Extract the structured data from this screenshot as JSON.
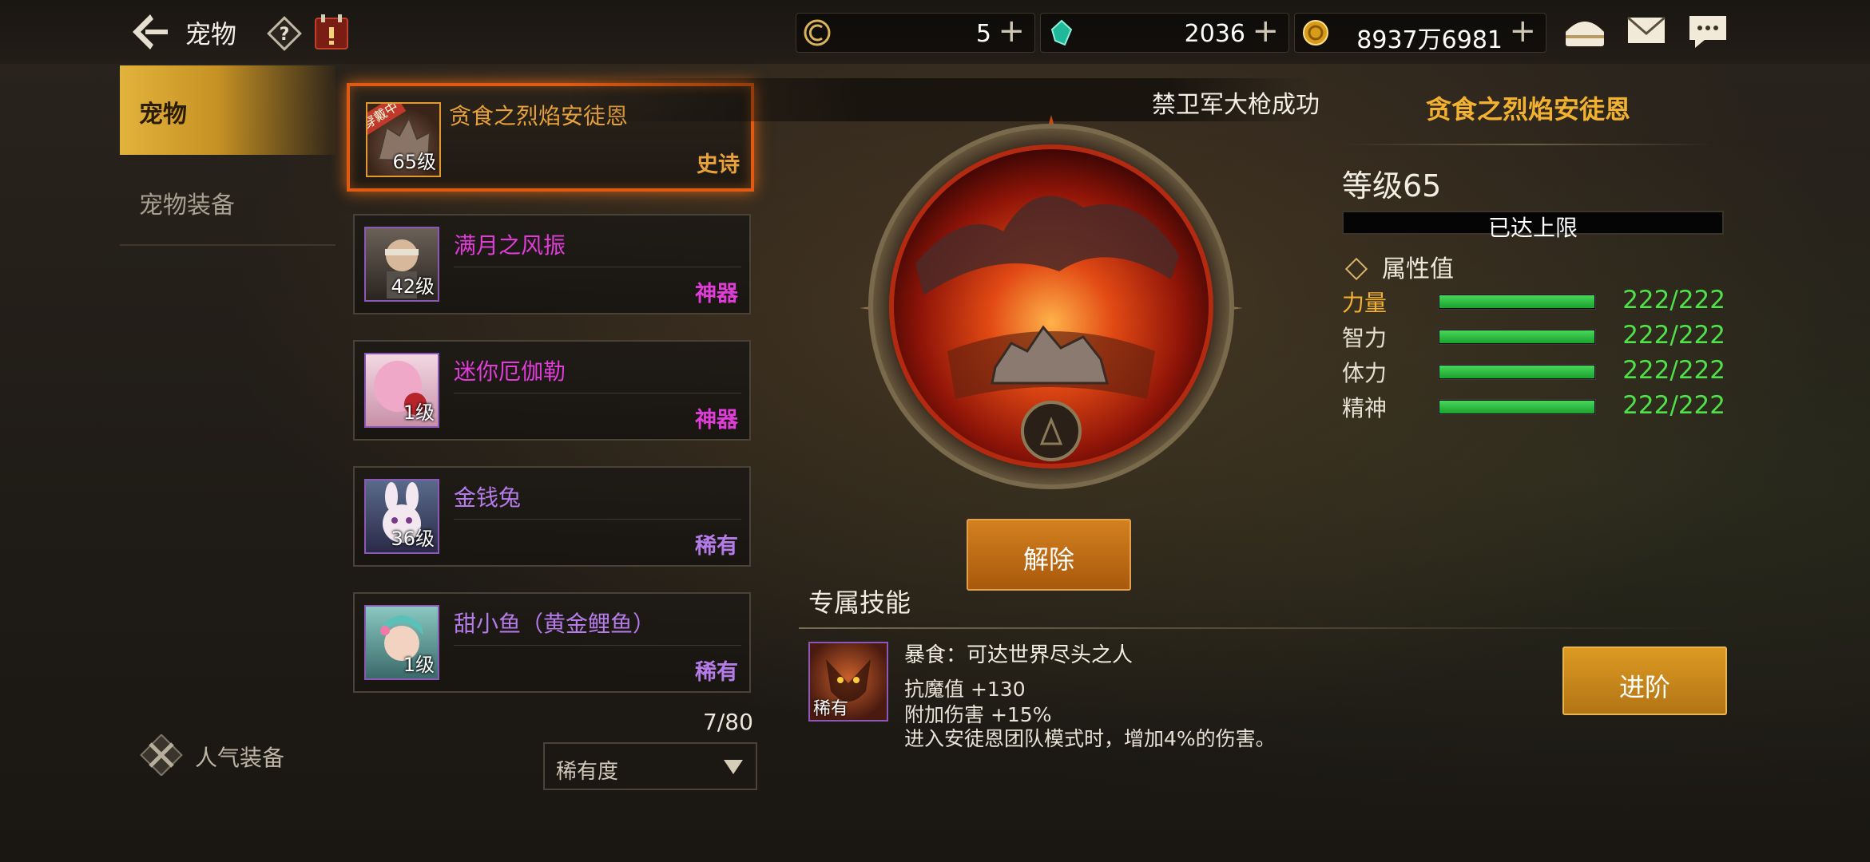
{
  "header": {
    "title": "宠物",
    "resources": [
      {
        "icon": "coupon-icon",
        "value": "5"
      },
      {
        "icon": "crystal-icon",
        "value": "2036"
      },
      {
        "icon": "gold-coin-icon",
        "value": "8937万6981"
      }
    ]
  },
  "nav": {
    "items": [
      {
        "label": "宠物",
        "active": true
      },
      {
        "label": "宠物装备",
        "active": false
      }
    ],
    "popular_label": "人气装备"
  },
  "pets": [
    {
      "name": "贪食之烈焰安徒恩",
      "level": "65级",
      "rarity": "史诗",
      "badge": "穿戴中",
      "name_color": "#e9a23a",
      "rarity_color": "#e9a23a"
    },
    {
      "name": "满月之风振",
      "level": "42级",
      "rarity": "神器",
      "name_color": "#e03cd8",
      "rarity_color": "#e03cd8"
    },
    {
      "name": "迷你厄伽勒",
      "level": "1级",
      "rarity": "神器",
      "name_color": "#e03cd8",
      "rarity_color": "#e03cd8"
    },
    {
      "name": "金钱兔",
      "level": "36级",
      "rarity": "稀有",
      "name_color": "#b57be8",
      "rarity_color": "#b57be8"
    },
    {
      "name": "甜小鱼（黄金鲤鱼）",
      "level": "1级",
      "rarity": "稀有",
      "name_color": "#b57be8",
      "rarity_color": "#b57be8"
    }
  ],
  "list": {
    "count": "7/80",
    "sort_label": "稀有度"
  },
  "banner_text": "禁卫军大枪成功",
  "release_label": "解除",
  "detail": {
    "name": "贪食之烈焰安徒恩",
    "level": "等级65",
    "max_text": "已达上限",
    "attr_title": "属性值",
    "stats": [
      {
        "label": "力量",
        "value": "222/222",
        "ratio": 1.0,
        "label_color": "#f2b230"
      },
      {
        "label": "智力",
        "value": "222/222",
        "ratio": 1.0,
        "label_color": "#e6e0d4"
      },
      {
        "label": "体力",
        "value": "222/222",
        "ratio": 1.0,
        "label_color": "#e6e0d4"
      },
      {
        "label": "精神",
        "value": "222/222",
        "ratio": 1.0,
        "label_color": "#e6e0d4"
      }
    ]
  },
  "skill": {
    "header": "专属技能",
    "icon_label": "稀有",
    "name": "暴食：可达世界尽头之人",
    "lines": [
      "抗魔值 +130",
      "附加伤害 +15%",
      "进入安徒恩团队模式时，增加4%的伤害。"
    ]
  },
  "advance_label": "进阶"
}
